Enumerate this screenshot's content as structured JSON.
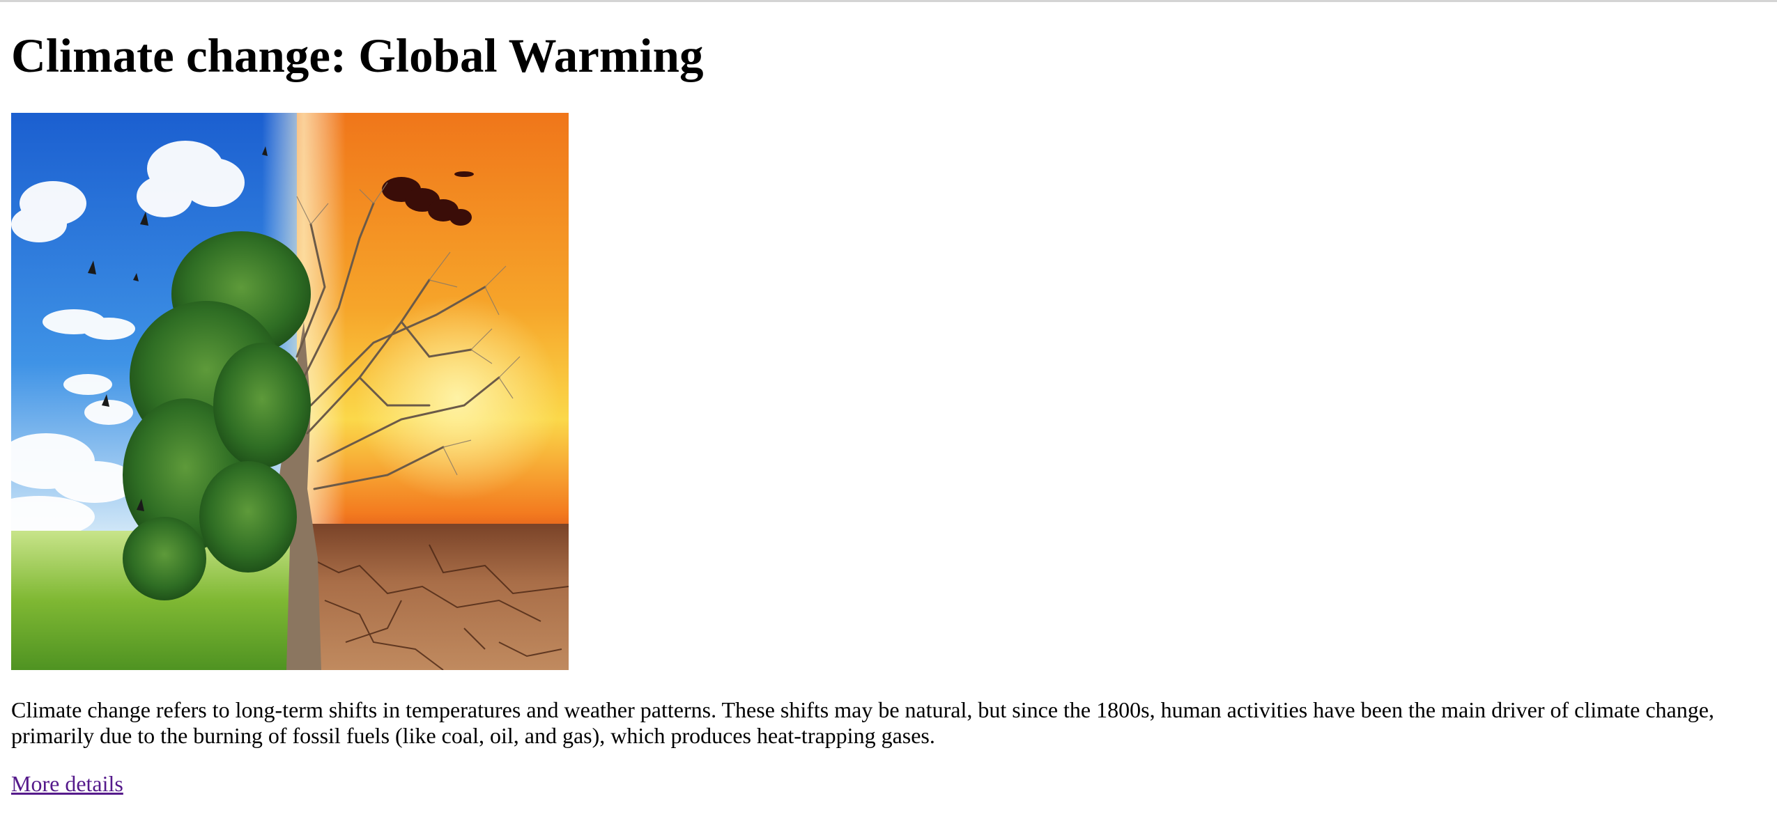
{
  "page": {
    "title": "Climate change: Global Warming",
    "body": "Climate change refers to long-term shifts in temperatures and weather patterns. These shifts may be natural, but since the 1800s, human activities have been the main driver of climate change, primarily due to the burning of fossil fuels (like coal, oil, and gas), which produces heat-trapping gases.",
    "link_label": "More details"
  },
  "colors": {
    "link_visited": "#551a8b",
    "sky_blue": "#2f7fdc",
    "sunset_orange": "#f07a16",
    "grass_green": "#6fae2c",
    "dry_earth": "#a06a44"
  },
  "hero_image": {
    "subject": "half-green half-dead tree climate illustration"
  }
}
